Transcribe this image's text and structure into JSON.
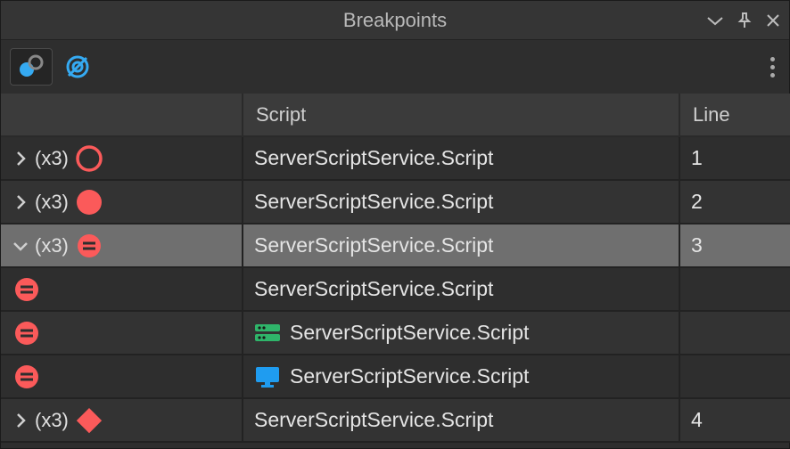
{
  "panel": {
    "title": "Breakpoints"
  },
  "columns": {
    "col0": "",
    "col1": "Script",
    "col2": "Line"
  },
  "colors": {
    "red": "#fb5a5a",
    "blue": "#35aaf2",
    "green": "#2fb56a",
    "monitorBlue": "#1f9cf0"
  },
  "rows": [
    {
      "type": "parent",
      "expanded": false,
      "count": "(x3)",
      "bpStyle": "hollow-red-circle",
      "script": "ServerScriptService.Script",
      "line": "1",
      "selected": false,
      "shade": "dark"
    },
    {
      "type": "parent",
      "expanded": false,
      "count": "(x3)",
      "bpStyle": "solid-red-circle",
      "script": "ServerScriptService.Script",
      "line": "2",
      "selected": false,
      "shade": "lite"
    },
    {
      "type": "parent",
      "expanded": true,
      "count": "(x3)",
      "bpStyle": "red-equals-circle",
      "script": "ServerScriptService.Script",
      "line": "3",
      "selected": true,
      "shade": "sel"
    },
    {
      "type": "child",
      "bpStyle": "red-equals-circle",
      "context": "none",
      "script": "ServerScriptService.Script",
      "line": "",
      "shade": "dark"
    },
    {
      "type": "child",
      "bpStyle": "red-equals-circle",
      "context": "server",
      "script": "ServerScriptService.Script",
      "line": "",
      "shade": "lite"
    },
    {
      "type": "child",
      "bpStyle": "red-equals-circle",
      "context": "client",
      "script": "ServerScriptService.Script",
      "line": "",
      "shade": "dark"
    },
    {
      "type": "parent",
      "expanded": false,
      "count": "(x3)",
      "bpStyle": "red-diamond",
      "script": "ServerScriptService.Script",
      "line": "4",
      "selected": false,
      "shade": "lite"
    }
  ]
}
